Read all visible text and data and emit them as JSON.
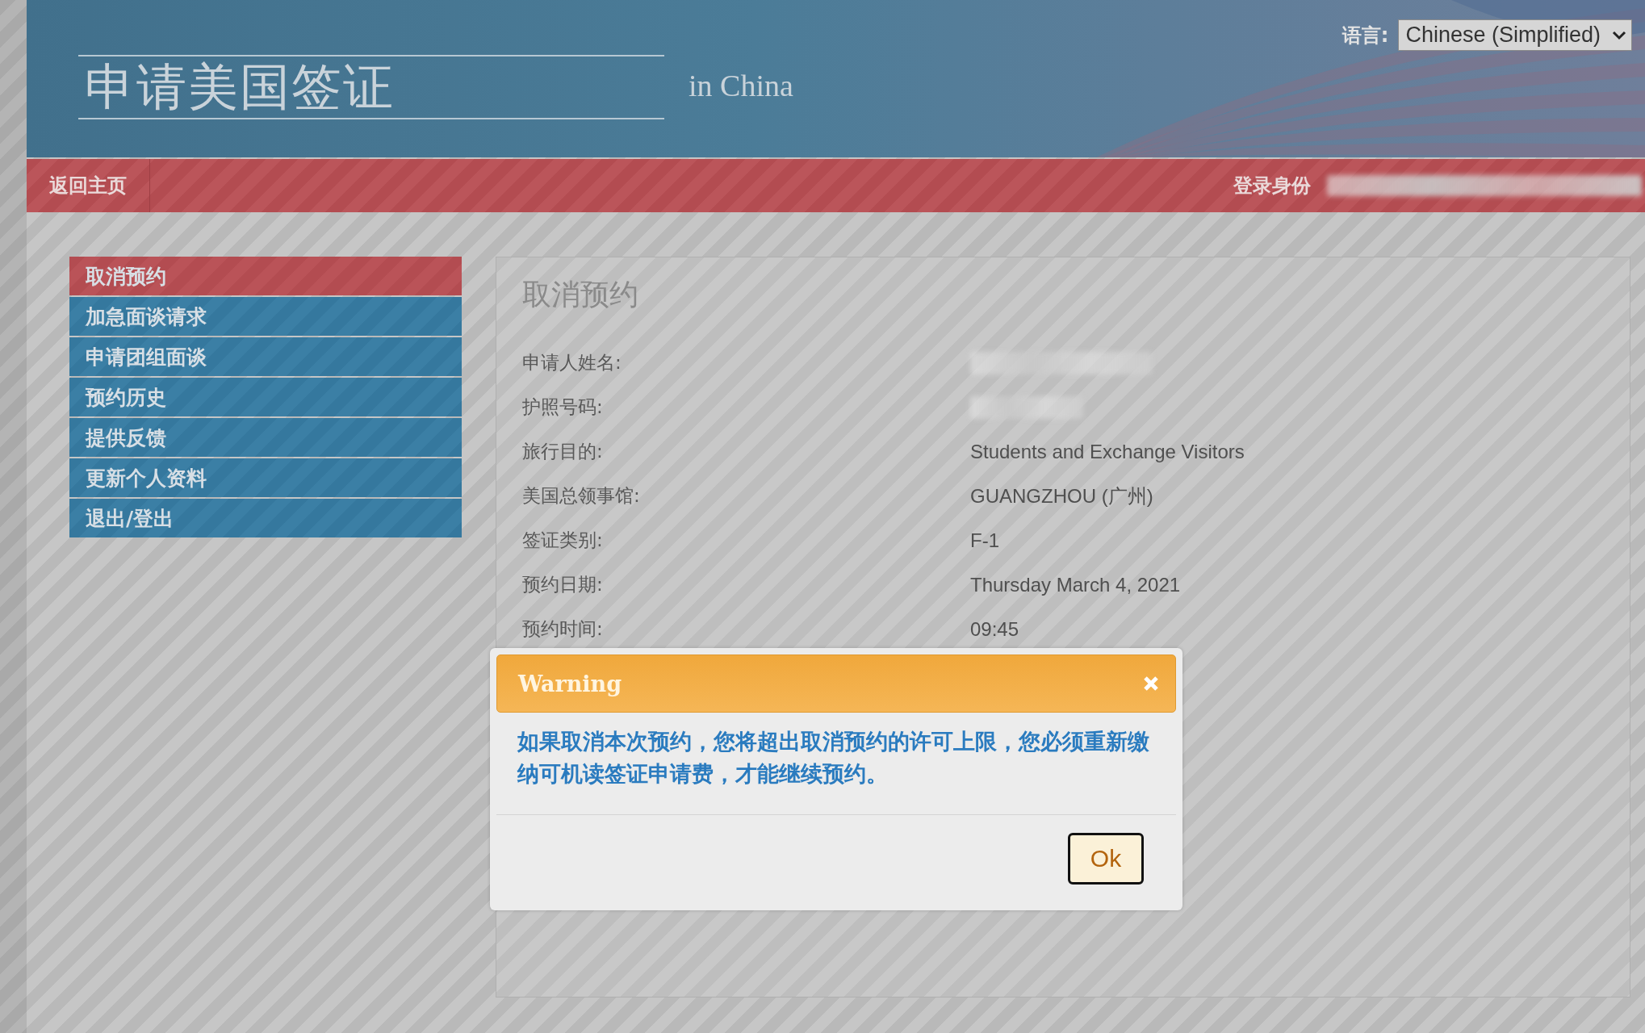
{
  "header": {
    "title": "申请美国签证",
    "subtitle": "in China",
    "language_label": "语言:",
    "language_value": "Chinese (Simplified)"
  },
  "nav_bar": {
    "home_link": "返回主页",
    "login_label": "登录身份",
    "login_redacted": true
  },
  "sidebar": {
    "items": [
      {
        "label": "取消预约",
        "selected": true
      },
      {
        "label": "加急面谈请求",
        "selected": false
      },
      {
        "label": "申请团组面谈",
        "selected": false
      },
      {
        "label": "预约历史",
        "selected": false
      },
      {
        "label": "提供反馈",
        "selected": false
      },
      {
        "label": "更新个人资料",
        "selected": false
      },
      {
        "label": "退出/登出",
        "selected": false
      }
    ]
  },
  "content": {
    "title": "取消预约",
    "details": [
      {
        "label": "申请人姓名:",
        "redacted": true
      },
      {
        "label": "护照号码:",
        "redacted": true
      },
      {
        "label": "旅行目的:",
        "value": "Students and Exchange Visitors",
        "redacted": false
      },
      {
        "label": "美国总领事馆:",
        "value": "GUANGZHOU (广州)",
        "redacted": false
      },
      {
        "label": "签证类别:",
        "value": "F-1",
        "redacted": false
      },
      {
        "label": "预约日期:",
        "value": "Thursday March 4, 2021",
        "redacted": false
      },
      {
        "label": "预约时间:",
        "value": "09:45",
        "redacted": false
      }
    ]
  },
  "dialog": {
    "title": "Warning",
    "message": "如果取消本次预约，您将超出取消预约的许可上限，您必须重新缴纳可机读签证申请费，才能继续预约。",
    "button": "Ok"
  }
}
